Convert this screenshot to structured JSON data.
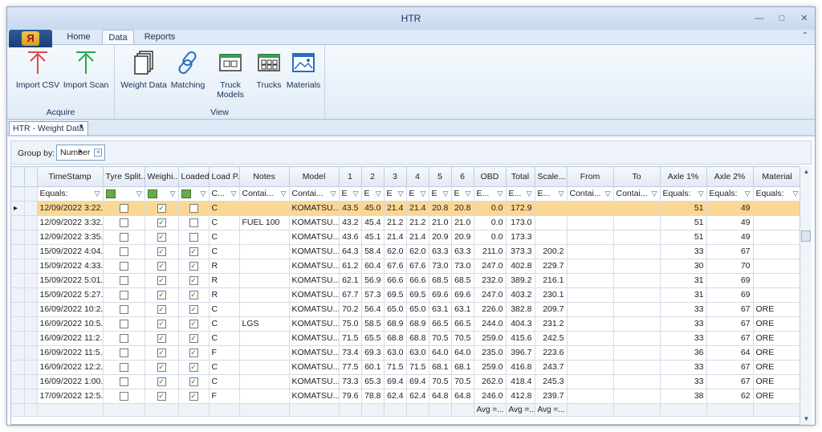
{
  "window": {
    "title": "HTR"
  },
  "ribbon": {
    "app_logo": "Я",
    "tabs": [
      "Home",
      "Data",
      "Reports"
    ],
    "active_tab": "Data",
    "groups": {
      "acquire": {
        "label": "Acquire",
        "buttons": [
          "Import CSV",
          "Import Scan"
        ]
      },
      "view": {
        "label": "View",
        "buttons": [
          "Weight Data",
          "Matching",
          "Truck Models",
          "Trucks",
          "Materials"
        ]
      }
    }
  },
  "doc_tab": {
    "label": "HTR - Weight Data"
  },
  "group_by": {
    "label": "Group by:",
    "chip": "Number"
  },
  "grid": {
    "columns": [
      "TimeStamp",
      "Tyre Split...",
      "Weighi...",
      "Loaded",
      "Load P...",
      "Notes",
      "Model",
      "1",
      "2",
      "3",
      "4",
      "5",
      "6",
      "OBD",
      "Total",
      "Scale...",
      "From",
      "To",
      "Axle 1%",
      "Axle 2%",
      "Material"
    ],
    "filters": [
      "Equals:",
      "",
      "",
      "",
      "C...",
      "Contai...",
      "Contai...",
      "E",
      "E",
      "E",
      "E",
      "E",
      "E",
      "E...",
      "E...",
      "E...",
      "Contai...",
      "Contai...",
      "Equals:",
      "Equals:",
      "Equals:"
    ],
    "rows": [
      [
        "12/09/2022 3:22...",
        "0",
        "1",
        "0",
        "C",
        "",
        "KOMATSU...",
        "43.5",
        "45.0",
        "21.4",
        "21.4",
        "20.8",
        "20.8",
        "0.0",
        "172.9",
        "",
        "",
        "",
        "51",
        "49",
        ""
      ],
      [
        "12/09/2022 3:32...",
        "0",
        "1",
        "0",
        "C",
        "FUEL 100",
        "KOMATSU...",
        "43.2",
        "45.4",
        "21.2",
        "21.2",
        "21.0",
        "21.0",
        "0.0",
        "173.0",
        "",
        "",
        "",
        "51",
        "49",
        ""
      ],
      [
        "12/09/2022 3:35...",
        "0",
        "1",
        "0",
        "C",
        "",
        "KOMATSU...",
        "43.6",
        "45.1",
        "21.4",
        "21.4",
        "20.9",
        "20.9",
        "0.0",
        "173.3",
        "",
        "",
        "",
        "51",
        "49",
        ""
      ],
      [
        "15/09/2022 4:04...",
        "0",
        "1",
        "1",
        "C",
        "",
        "KOMATSU...",
        "64.3",
        "58.4",
        "62.0",
        "62.0",
        "63.3",
        "63.3",
        "211.0",
        "373.3",
        "200.2",
        "",
        "",
        "33",
        "67",
        ""
      ],
      [
        "15/09/2022 4:33...",
        "0",
        "1",
        "1",
        "R",
        "",
        "KOMATSU...",
        "61.2",
        "60.4",
        "67.6",
        "67.6",
        "73.0",
        "73.0",
        "247.0",
        "402.8",
        "229.7",
        "",
        "",
        "30",
        "70",
        ""
      ],
      [
        "15/09/2022 5:01...",
        "0",
        "1",
        "1",
        "R",
        "",
        "KOMATSU...",
        "62.1",
        "56.9",
        "66.6",
        "66.6",
        "68.5",
        "68.5",
        "232.0",
        "389.2",
        "216.1",
        "",
        "",
        "31",
        "69",
        ""
      ],
      [
        "15/09/2022 5:27...",
        "0",
        "1",
        "1",
        "R",
        "",
        "KOMATSU...",
        "67.7",
        "57.3",
        "69.5",
        "69.5",
        "69.6",
        "69.6",
        "247.0",
        "403.2",
        "230.1",
        "",
        "",
        "31",
        "69",
        ""
      ],
      [
        "16/09/2022 10:2...",
        "0",
        "1",
        "1",
        "C",
        "",
        "KOMATSU...",
        "70.2",
        "56.4",
        "65.0",
        "65.0",
        "63.1",
        "63.1",
        "226.0",
        "382.8",
        "209.7",
        "",
        "",
        "33",
        "67",
        "ORE"
      ],
      [
        "16/09/2022 10:5...",
        "0",
        "1",
        "1",
        "C",
        "LGS",
        "KOMATSU...",
        "75.0",
        "58.5",
        "68.9",
        "68.9",
        "66.5",
        "66.5",
        "244.0",
        "404.3",
        "231.2",
        "",
        "",
        "33",
        "67",
        "ORE"
      ],
      [
        "16/09/2022 11:2...",
        "0",
        "1",
        "1",
        "C",
        "",
        "KOMATSU...",
        "71.5",
        "65.5",
        "68.8",
        "68.8",
        "70.5",
        "70.5",
        "259.0",
        "415.6",
        "242.5",
        "",
        "",
        "33",
        "67",
        "ORE"
      ],
      [
        "16/09/2022 11:5...",
        "0",
        "1",
        "1",
        "F",
        "",
        "KOMATSU...",
        "73.4",
        "69.3",
        "63.0",
        "63.0",
        "64.0",
        "64.0",
        "235.0",
        "396.7",
        "223.6",
        "",
        "",
        "36",
        "64",
        "ORE"
      ],
      [
        "16/09/2022 12:2...",
        "0",
        "1",
        "1",
        "C",
        "",
        "KOMATSU...",
        "77.5",
        "60.1",
        "71.5",
        "71.5",
        "68.1",
        "68.1",
        "259.0",
        "416.8",
        "243.7",
        "",
        "",
        "33",
        "67",
        "ORE"
      ],
      [
        "16/09/2022 1:00...",
        "0",
        "1",
        "1",
        "C",
        "",
        "KOMATSU...",
        "73.3",
        "65.3",
        "69.4",
        "69.4",
        "70.5",
        "70.5",
        "262.0",
        "418.4",
        "245.3",
        "",
        "",
        "33",
        "67",
        "ORE"
      ],
      [
        "17/09/2022 12:5...",
        "0",
        "1",
        "1",
        "F",
        "",
        "KOMATSU...",
        "79.6",
        "78.8",
        "62.4",
        "62.4",
        "64.8",
        "64.8",
        "246.0",
        "412.8",
        "239.7",
        "",
        "",
        "38",
        "62",
        "ORE"
      ]
    ],
    "footer": [
      "Avg =...",
      "Avg =...",
      "Avg =..."
    ]
  },
  "colors": {
    "selected_row": "#fbd795",
    "accent": "#15325c"
  }
}
